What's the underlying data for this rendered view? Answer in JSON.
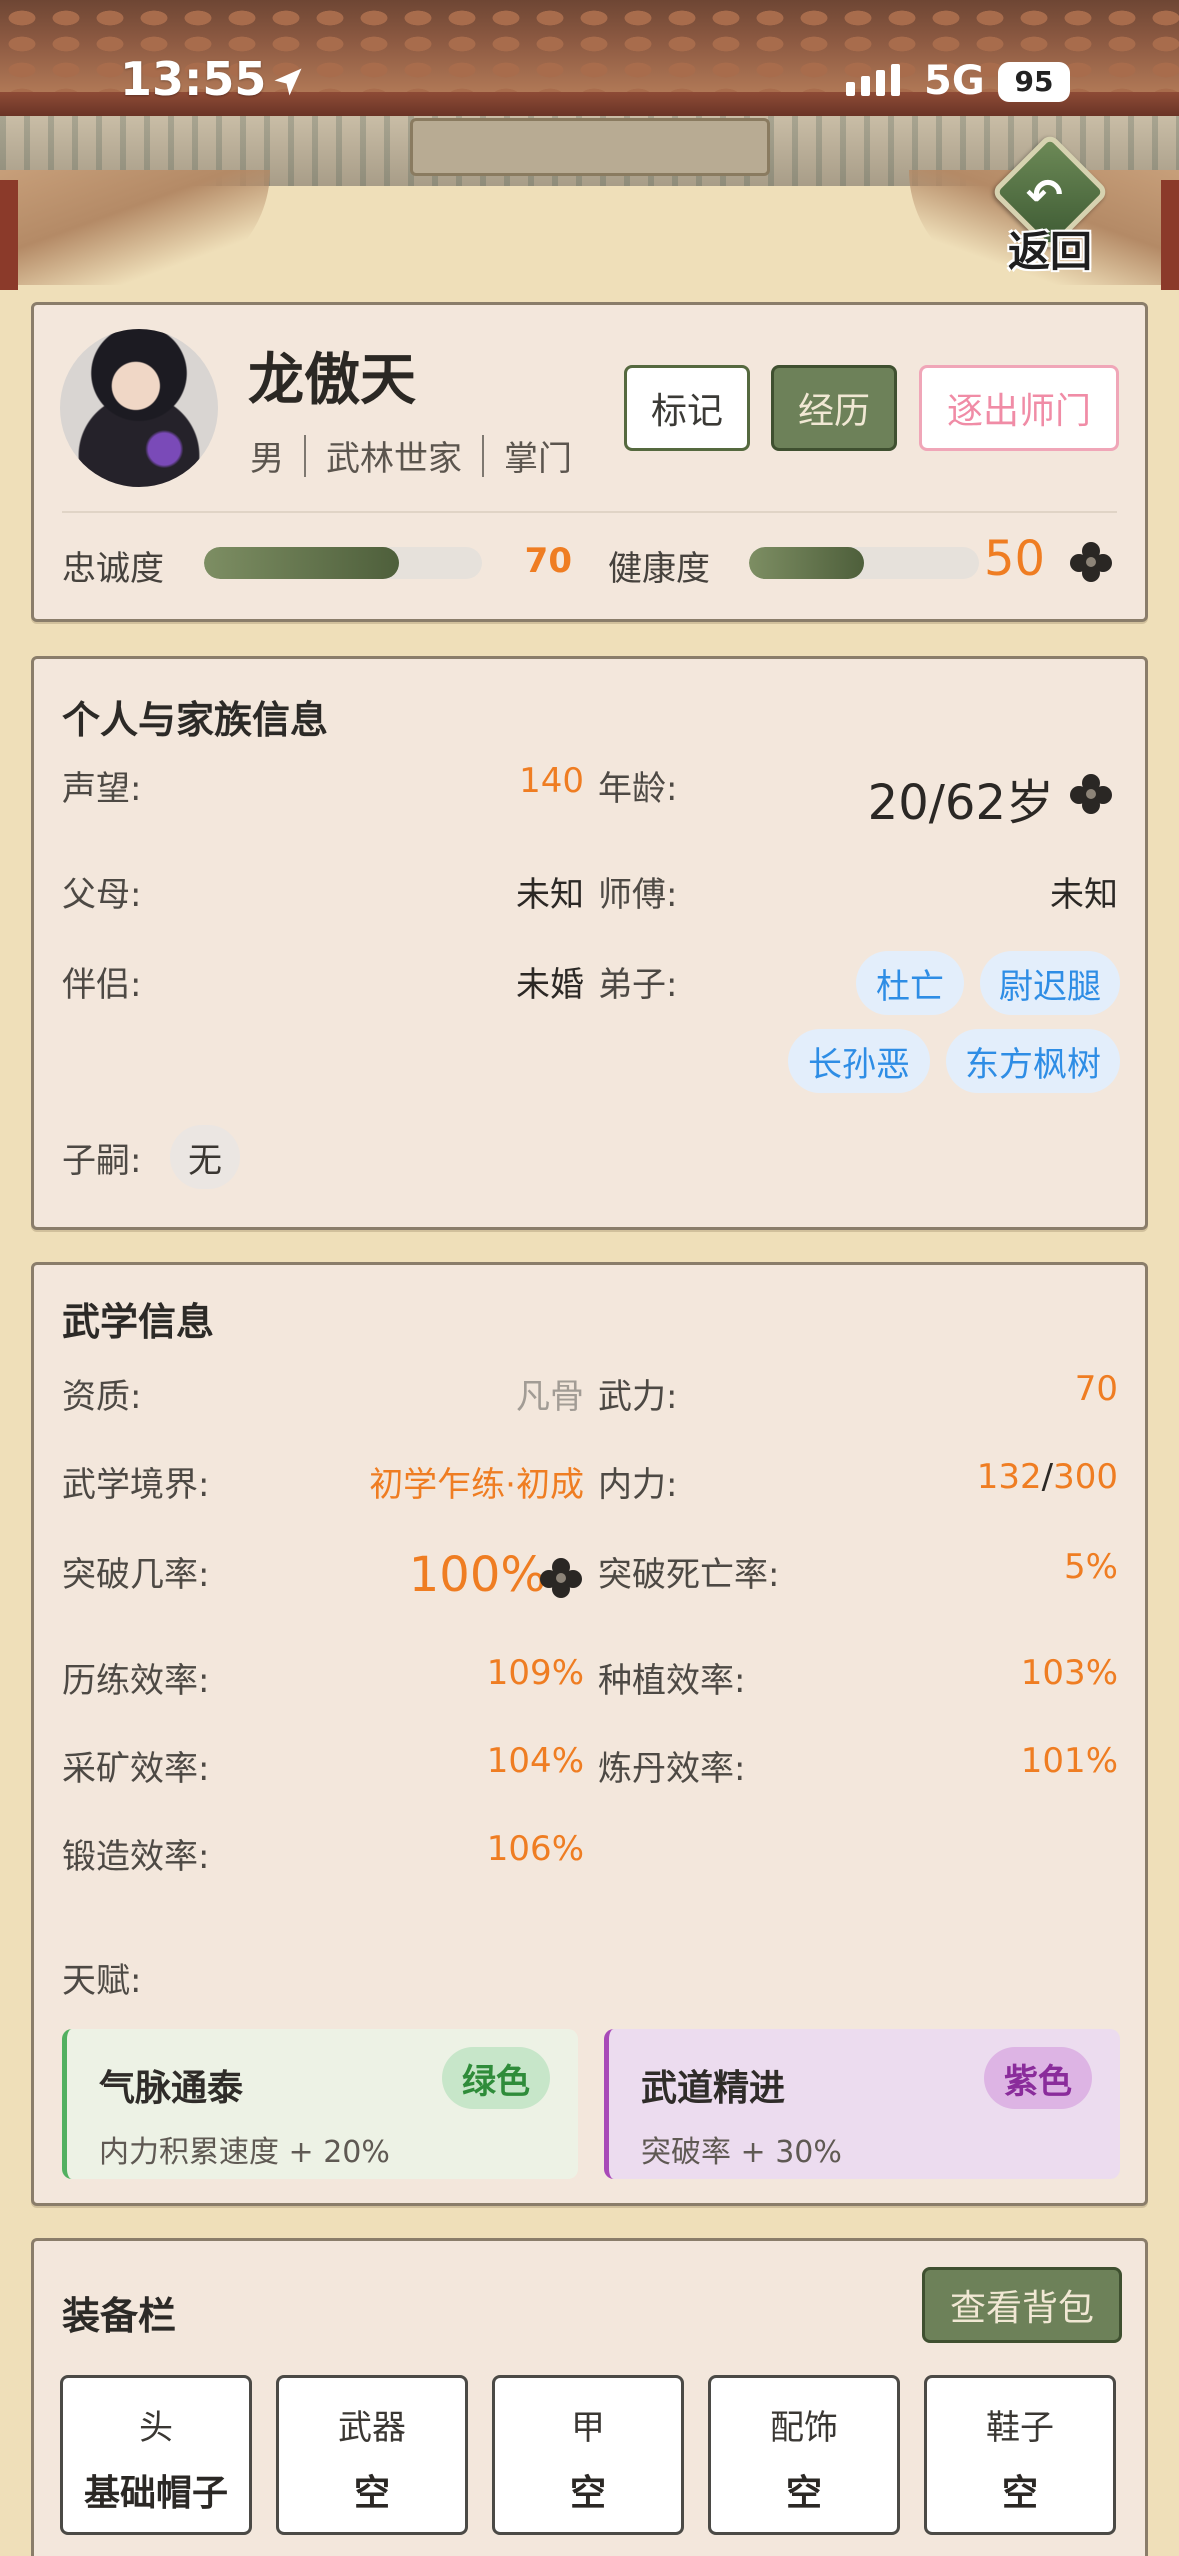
{
  "status_bar": {
    "time": "13:55",
    "network": "5G",
    "battery": "95"
  },
  "header": {
    "back_label": "返回"
  },
  "profile": {
    "name": "龙傲天",
    "gender": "男",
    "origin": "武林世家",
    "role": "掌门",
    "buttons": {
      "mark": "标记",
      "history": "经历",
      "expel": "逐出师门"
    },
    "loyalty": {
      "label": "忠诚度",
      "value": "70",
      "fraction": 0.7
    },
    "health": {
      "label": "健康度",
      "value": "50",
      "fraction": 0.5
    }
  },
  "personal": {
    "title": "个人与家族信息",
    "reputation_label": "声望:",
    "reputation": "140",
    "age_label": "年龄:",
    "age": "20/62岁",
    "parents_label": "父母:",
    "parents": "未知",
    "master_label": "师傅:",
    "master": "未知",
    "spouse_label": "伴侣:",
    "spouse": "未婚",
    "disciples_label": "弟子:",
    "disciples": [
      "杜亡",
      "尉迟腿",
      "长孙恶",
      "东方枫树"
    ],
    "heirs_label": "子嗣:",
    "heirs": "无"
  },
  "martial": {
    "title": "武学信息",
    "aptitude_label": "资质:",
    "aptitude": "凡骨",
    "force_label": "武力:",
    "force": "70",
    "realm_label": "武学境界:",
    "realm": "初学乍练·初成",
    "inner_label": "内力:",
    "inner_current": "132",
    "inner_sep": "/",
    "inner_max": "300",
    "breakthrough_label": "突破几率:",
    "breakthrough": "100%",
    "death_label": "突破死亡率:",
    "death": "5%",
    "train_label": "历练效率:",
    "train": "109%",
    "plant_label": "种植效率:",
    "plant": "103%",
    "mine_label": "采矿效率:",
    "mine": "104%",
    "alchemy_label": "炼丹效率:",
    "alchemy": "101%",
    "forge_label": "锻造效率:",
    "forge": "106%",
    "talent_label": "天赋:",
    "talents": [
      {
        "name": "气脉通泰",
        "tag": "绿色",
        "desc": "内力积累速度 + 20%",
        "color": "#52b060"
      },
      {
        "name": "武道精进",
        "tag": "紫色",
        "desc": "突破率 + 30%",
        "color": "#a84ab8"
      }
    ]
  },
  "equipment": {
    "title": "装备栏",
    "bag_button": "查看背包",
    "slots": [
      {
        "name": "头",
        "value": "基础帽子"
      },
      {
        "name": "武器",
        "value": "空"
      },
      {
        "name": "甲",
        "value": "空"
      },
      {
        "name": "配饰",
        "value": "空"
      },
      {
        "name": "鞋子",
        "value": "空"
      }
    ]
  },
  "colors": {
    "accent_orange": "#ef7d22",
    "olive_button": "#6d8159",
    "chip_blue": "#2e8de5"
  }
}
